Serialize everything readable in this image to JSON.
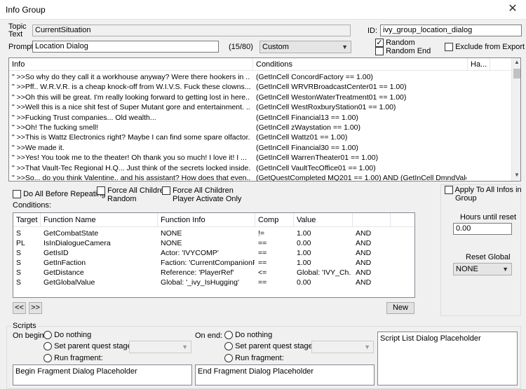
{
  "window": {
    "title": "Info Group",
    "close_glyph": "✕"
  },
  "topic_text": {
    "label": "Topic Text",
    "value": "CurrentSituation"
  },
  "id": {
    "label": "ID:",
    "value": "ivy_group_location_dialog"
  },
  "prompt": {
    "label": "Prompt:",
    "value": "Location Dialog",
    "counter": "(15/80)",
    "mode": "Custom"
  },
  "flags": {
    "random": "Random",
    "random_end": "Random End",
    "exclude": "Exclude from Export"
  },
  "info_list": {
    "columns": [
      "Info",
      "Conditions",
      "Ha..."
    ],
    "rows": [
      {
        "info": "\" >>So why do they call it a workhouse anyway? Were there hookers in ...",
        "cond": "(GetInCell ConcordFactory == 1.00)"
      },
      {
        "info": "\" >>Pff.. W.R.V.R. is a cheap knock-off from W.I.V.S. Fuck these clowns...",
        "cond": "(GetInCell WRVRBroadcastCenter01 == 1.00)"
      },
      {
        "info": "\" >>Oh this will be great. I'm really looking forward to getting lost in here...",
        "cond": "(GetInCell WestonWaterTreatment01 == 1.00)"
      },
      {
        "info": "\" >>Well this is a nice shit fest of Super Mutant gore and entertainment. ...",
        "cond": "(GetInCell WestRoxburyStation01 == 1.00)"
      },
      {
        "info": "\" >>Fucking Trust companies... Old wealth...",
        "cond": "(GetInCell Financial13 == 1.00)"
      },
      {
        "info": "\" >>Oh! The fucking smell!",
        "cond": "(GetInCell zWaystation == 1.00)"
      },
      {
        "info": "\" >>This is Wattz Electronics right? Maybe I can find some spare olfactor...",
        "cond": "(GetInCell Wattz01 == 1.00)"
      },
      {
        "info": "\" >>We made it.",
        "cond": "(GetInCell Financial30 == 1.00)"
      },
      {
        "info": "\" >>Yes! You took me to the theater! Oh thank you so much! I love it! I ...",
        "cond": "(GetInCell WarrenTheater01 == 1.00)"
      },
      {
        "info": "\" >>That Vault-Tec Regional H.Q... Just think of the secrets locked inside...",
        "cond": "(GetInCell VaultTecOffice01 == 1.00)"
      },
      {
        "info": "\" >>So... do you think Valentine.. and his assistant? How does that even...",
        "cond": "(GetQuestCompleted MQ201 == 1.00) AND (GetInCell DmndValentines..."
      }
    ]
  },
  "options": {
    "do_all": "Do All Before Repeating",
    "force_random_1": "Force All Children",
    "force_random_2": "Random",
    "force_player_1": "Force All Children",
    "force_player_2": "Player Activate Only",
    "apply_all_1": "Apply To All Infos in",
    "apply_all_2": "Group"
  },
  "conditions": {
    "label": "Conditions:",
    "columns": [
      "Target",
      "Function Name",
      "Function Info",
      "Comp",
      "Value",
      ""
    ],
    "rows": [
      [
        "S",
        "GetCombatState",
        "NONE",
        "!=",
        "1.00",
        "AND"
      ],
      [
        "PL",
        "IsInDialogueCamera",
        "NONE",
        "==",
        "0.00",
        "AND"
      ],
      [
        "S",
        "GetIsID",
        "Actor: 'IVYCOMP'",
        "==",
        "1.00",
        "AND"
      ],
      [
        "S",
        "GetInFaction",
        "Faction: 'CurrentCompanionF...",
        "==",
        "1.00",
        "AND"
      ],
      [
        "S",
        "GetDistance",
        "Reference: 'PlayerRef'",
        "<=",
        "Global: 'IVY_Ch...",
        "AND"
      ],
      [
        "S",
        "GetGlobalValue",
        "Global: '_ivy_IsHugging'",
        "==",
        "0.00",
        "AND"
      ]
    ],
    "prev": "<<",
    "next": ">>",
    "new": "New"
  },
  "hours": {
    "label": "Hours until reset",
    "value": "0.00"
  },
  "reset_global": {
    "label": "Reset Global",
    "value": "NONE"
  },
  "scripts": {
    "label": "Scripts",
    "on_begin": "On begin:",
    "on_end": "On end:",
    "do_nothing": "Do nothing",
    "set_stage": "Set parent quest stage:",
    "run_fragment": "Run fragment:",
    "begin_ph": "Begin Fragment Dialog Placeholder",
    "end_ph": "End Fragment Dialog Placeholder",
    "list_ph": "Script List Dialog Placeholder"
  }
}
